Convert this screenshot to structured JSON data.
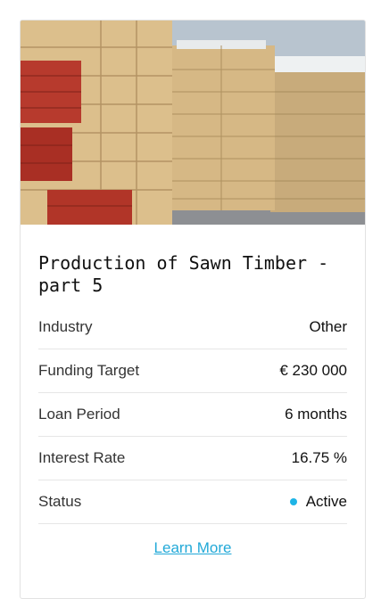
{
  "project": {
    "title": "Production of Sawn Timber - part 5",
    "image_alt": "stacks of sawn timber"
  },
  "details": [
    {
      "label": "Industry",
      "value": "Other"
    },
    {
      "label": "Funding Target",
      "value": "€ 230 000"
    },
    {
      "label": "Loan Period",
      "value": "6 months"
    },
    {
      "label": "Interest Rate",
      "value": "16.75 %"
    }
  ],
  "status": {
    "label": "Status",
    "value": "Active",
    "color": "#1eb4e6"
  },
  "link": {
    "learn_more": "Learn More"
  },
  "colors": {
    "accent": "#22a9d8"
  }
}
